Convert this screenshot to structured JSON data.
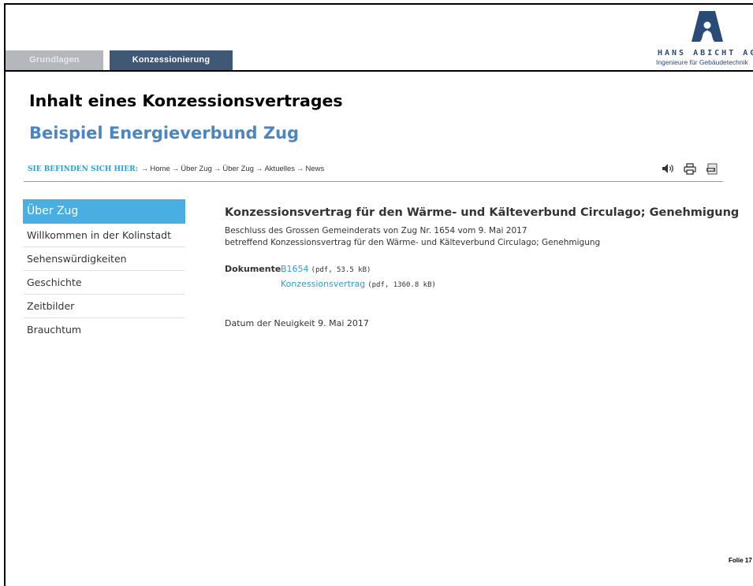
{
  "tabs": [
    {
      "label": "Grundlagen",
      "active": false
    },
    {
      "label": "Konzessionierung",
      "active": true
    }
  ],
  "logo": {
    "name": "HANS ABICHT AG",
    "tagline": "Ingenieure für Gebäudetechnik",
    "color": "#2a4a78",
    "icon": "abicht-logo-icon"
  },
  "slide": {
    "title": "Inhalt eines Konzessionsvertrages",
    "subtitle": "Beispiel Energieverbund Zug",
    "folio": "Folie 17"
  },
  "breadcrumb": {
    "label": "SIE BEFINDEN SICH HIER:",
    "items": [
      "Home",
      "Über Zug",
      "Über Zug",
      "Aktuelles",
      "News"
    ]
  },
  "tools": {
    "icons": [
      "speaker-icon",
      "print-icon",
      "pdf-icon"
    ]
  },
  "sidebar": {
    "items": [
      {
        "label": "Über Zug",
        "active": true
      },
      {
        "label": "Willkommen in der Kolinstadt",
        "active": false
      },
      {
        "label": "Sehenswürdigkeiten",
        "active": false
      },
      {
        "label": "Geschichte",
        "active": false
      },
      {
        "label": "Zeitbilder",
        "active": false
      },
      {
        "label": "Brauchtum",
        "active": false
      }
    ]
  },
  "article": {
    "title": "Konzessionsvertrag für den Wärme- und Kälteverbund Circulago; Genehmigung",
    "desc_line1": "Beschluss des Grossen Gemeinderats von Zug Nr. 1654 vom 9. Mai 2017",
    "desc_line2": "betreffend Konzessionsvertrag für den Wärme- und Kälteverbund Circulago; Genehmigung",
    "documents_label": "Dokumente",
    "documents": [
      {
        "name": "B1654",
        "meta": "(pdf, 53.5 kB)"
      },
      {
        "name": "Konzessionsvertrag",
        "meta": "(pdf, 1360.8 kB)"
      }
    ],
    "date": "Datum der Neuigkeit 9. Mai 2017"
  },
  "colors": {
    "accent_blue": "#49aee2",
    "link_blue": "#2aa0d8",
    "subtitle_blue": "#4a86c5",
    "tab_active": "#3f5875",
    "tab_inactive": "#b4b8bd"
  }
}
